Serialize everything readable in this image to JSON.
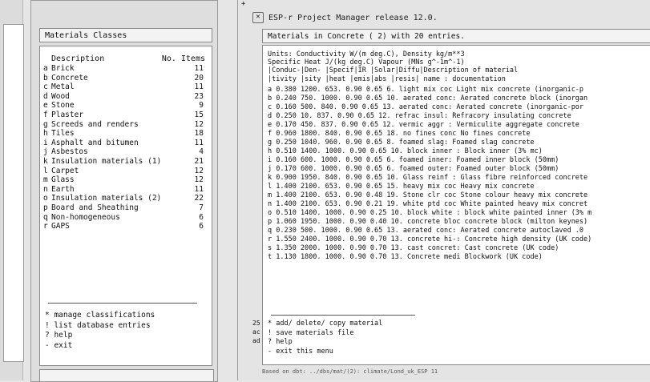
{
  "materials_classes_window": {
    "title": "Materials Classes",
    "header": {
      "description": "Description",
      "count_label": "No. Items"
    },
    "classes": [
      {
        "key": "a",
        "name": "Brick",
        "count": "11"
      },
      {
        "key": "b",
        "name": "Concrete",
        "count": "20"
      },
      {
        "key": "c",
        "name": "Metal",
        "count": "11"
      },
      {
        "key": "d",
        "name": "Wood",
        "count": "23"
      },
      {
        "key": "e",
        "name": "Stone",
        "count": "9"
      },
      {
        "key": "f",
        "name": "Plaster",
        "count": "15"
      },
      {
        "key": "g",
        "name": "Screeds and renders",
        "count": "12"
      },
      {
        "key": "h",
        "name": "Tiles",
        "count": "18"
      },
      {
        "key": "i",
        "name": "Asphalt and bitumen",
        "count": "11"
      },
      {
        "key": "j",
        "name": "Asbestos",
        "count": "4"
      },
      {
        "key": "k",
        "name": "Insulation materials (1)",
        "count": "21"
      },
      {
        "key": "l",
        "name": "Carpet",
        "count": "12"
      },
      {
        "key": "m",
        "name": "Glass",
        "count": "12"
      },
      {
        "key": "n",
        "name": "Earth",
        "count": "11"
      },
      {
        "key": "o",
        "name": "Insulation materials (2)",
        "count": "22"
      },
      {
        "key": "p",
        "name": "Board and Sheathing",
        "count": "7"
      },
      {
        "key": "q",
        "name": "Non-homogeneous",
        "count": "6"
      },
      {
        "key": "r",
        "name": "GAPS",
        "count": "6"
      }
    ],
    "menu": [
      "* manage classifications",
      "! list database entries",
      "? help",
      "- exit"
    ]
  },
  "project_manager_window": {
    "title": "ESP-r Project Manager release 12.0.",
    "subtitle": "Materials in Concrete ( 2) with 20 entries.",
    "header_lines": [
      "Units: Conductivity W/(m deg.C), Density kg/m**3",
      "Specific Heat J/(kg deg.C) Vapour (MNs g^-1m^-1)",
      " |Conduc-|Den- |Specif|IR  |Solar|Diffu|Description of material",
      " |tivity |sity |heat  |emis|abs  |resis| name       : documentation"
    ],
    "rows": [
      "a   0.380 1200.   653. 0.90 0.65    6. light mix coc Light mix concrete (inorganic-p",
      "b   0.240  750.  1000. 0.90 0.65   10. aerated conc: Aerated concrete block (inorgan",
      "c   0.160  500.   840. 0.90 0.65   13. aerated conc: Aerated concrete (inorganic-por",
      "d   0.250   10.   837. 0.90 0.65   12. refrac insul: Refracory insulating concrete",
      "e   0.170  450.   837. 0.90 0.65   12. vermic aggr : Vermiculite aggregate concrete",
      "f   0.960 1800.   840. 0.90 0.65   18. no fines conc No fines concrete",
      "g   0.250 1040.   960. 0.90 0.65    8. foamed slag: Foamed slag concrete",
      "h   0.510 1400.  1000. 0.90 0.65   10. block inner : Block inner (3% mc)",
      "i   0.160  600.  1000. 0.90 0.65    6. foamed inner: Foamed inner block (50mm)",
      "j   0.170  600.  1000. 0.90 0.65    6. foamed outer: Foamed outer block (50mm)",
      "k   0.900 1950.   840. 0.90 0.65   10. Glass reinf : Glass fibre reinforced concrete",
      "l   1.400 2100.   653. 0.90 0.65   15. heavy mix coc Heavy mix concrete",
      "m   1.400 2100.   653. 0.90 0.48   19. Stone clr coc Stone colour heavy mix concrete",
      "n   1.400 2100.   653. 0.90 0.21   19. white ptd coc White painted heavy mix concret",
      "o   0.510 1400.  1000. 0.90 0.25   10. block white : block white painted inner (3% m",
      "p   1.060 1950.  1000. 0.90 0.40   10. concrete bloc concrete block (milton keynes)",
      "q   0.230  500.  1000. 0.90 0.65   13. aerated conc: Aerated concrete autoclaved  .0",
      "r   1.550 2400.  1000. 0.90 0.70   13. concrete hi-: Concrete high density (UK code)",
      "s   1.350 2000.  1000. 0.90 0.70   13. cast concret: Cast concrete (UK code)",
      "t   1.130 1800.  1000. 0.90 0.70   13. Concrete medi Blockwork (UK code)"
    ],
    "menu": [
      "* add/ delete/ copy material",
      "! save materials file",
      "? help",
      "- exit this menu"
    ],
    "status_line": "Based on dbt: ../dbs/mat/(2):  climate/Lond_uk_ESP  11",
    "left_strip": [
      "25",
      "ac",
      "ad"
    ],
    "corner_mark": "+"
  }
}
